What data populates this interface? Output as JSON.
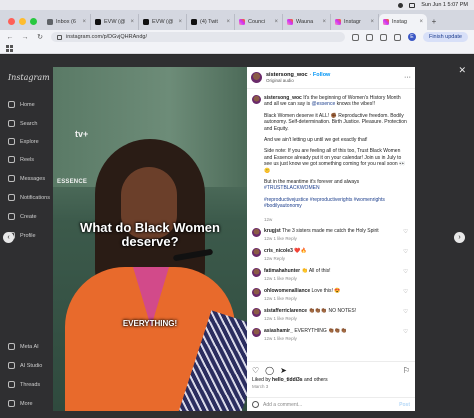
{
  "menubar": {
    "datetime": "Sun Jun 1  5:07 PM"
  },
  "tabs": [
    {
      "label": "Inbox (6",
      "icon": "mail-icon"
    },
    {
      "label": "EVW (@",
      "icon": "x-icon"
    },
    {
      "label": "EVW (@",
      "icon": "x-icon"
    },
    {
      "label": "(4) Twit",
      "icon": "x-icon"
    },
    {
      "label": "Counci",
      "icon": "instagram-icon"
    },
    {
      "label": "Wauna",
      "icon": "instagram-icon"
    },
    {
      "label": "Instagr",
      "icon": "instagram-icon"
    },
    {
      "label": "Instag",
      "icon": "instagram-icon",
      "active": true
    }
  ],
  "toolbar": {
    "url": "instagram.com/p/DGvjQHRAndg/",
    "profile_initial": "E",
    "finish_update": "Finish update"
  },
  "sidebar": {
    "logo": "Instagram",
    "items": [
      "Home",
      "Search",
      "Explore",
      "Reels",
      "Messages",
      "Notifications",
      "Create",
      "Profile",
      "Meta AI",
      "AI Studio",
      "Threads",
      "More"
    ]
  },
  "post": {
    "username": "sistersong_woc",
    "follow": "Follow",
    "audio": "Original audio",
    "caption_user": "sistersong_woc",
    "caption_p1": "It's the beginning of Women's History Month and all we can say is",
    "caption_p1_tag": "@essence",
    "caption_p1_end": "knows the vibes!!",
    "caption_p2": "Black Women deserve it ALL! ✊🏾 Reproductive freedom. Bodily autonomy. Self-determination. Birth Justice. Pleasure. Protection and Equity.",
    "caption_p3": "And we ain't letting up until we get exactly that!",
    "caption_p4": "Side note: If you are feeling all of this too, Trust Black Women and Essence already put it on your calendar! Join us in July to see us just know we got something coming for you real soon 👀🤫",
    "caption_p5": "But in the meantime it's forever and always",
    "caption_p5_tag": "#TRUSTBLACKWOMEN",
    "caption_tags": "#reproductivejustice #reproductiverights #womenrights #bodilyautonomy",
    "caption_age": "12w",
    "video_caption_1": "What do Black Women deserve?",
    "video_caption_2": "EVERYTHING!",
    "video_brand": "tv+",
    "video_essence": "ESSENCE"
  },
  "comments": [
    {
      "user": "krugjst",
      "text": "The 3 sisters made me catch the Holy Spirit",
      "age": "12w",
      "likes": "1 like",
      "reply": "Reply"
    },
    {
      "user": "cris_nicole3",
      "text": "❤️🔥",
      "age": "12w",
      "likes": "",
      "reply": "Reply"
    },
    {
      "user": "fatimahahunter",
      "text": "👏 All of this!",
      "age": "12w",
      "likes": "1 like",
      "reply": "Reply"
    },
    {
      "user": "ohlowomenalliance",
      "text": "Love this! 😍",
      "age": "12w",
      "likes": "1 like",
      "reply": "Reply"
    },
    {
      "user": "sistafferriclarence",
      "text": "👏🏾👏🏾👏🏾 NO NOTES!",
      "age": "12w",
      "likes": "1 like",
      "reply": "Reply"
    },
    {
      "user": "asiashamir_",
      "text": "EVERYTHING 👏🏾👏🏾👏🏾",
      "age": "12w",
      "likes": "1 like",
      "reply": "Reply"
    }
  ],
  "footer": {
    "likes_prefix": "Liked by",
    "likes_user": "hello_tiddi3s",
    "likes_suffix": "and others",
    "date": "March 3",
    "add_comment": "Add a comment...",
    "post_btn": "Post"
  }
}
